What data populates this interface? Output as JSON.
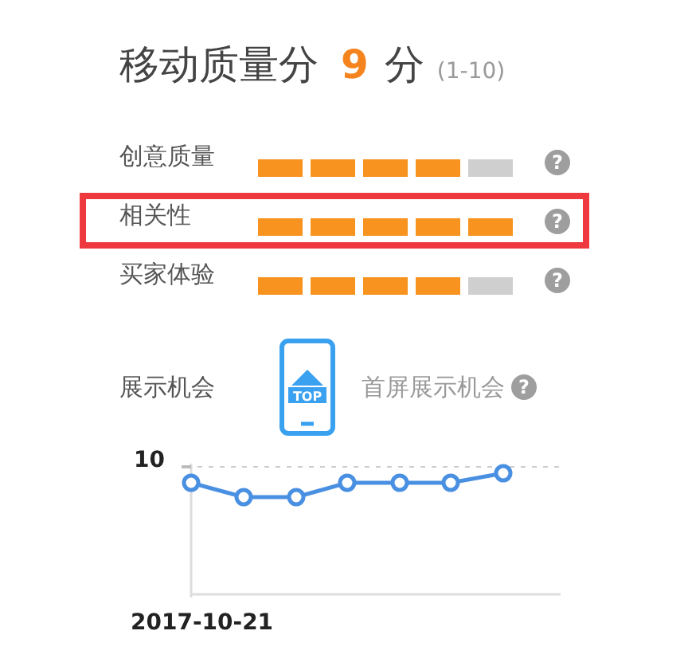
{
  "title": {
    "label": "移动质量分",
    "score": "9",
    "unit": "分",
    "range": "(1-10)"
  },
  "metrics": [
    {
      "label": "创意质量",
      "segments": [
        {
          "on": true
        },
        {
          "on": true
        },
        {
          "on": true
        },
        {
          "on": true
        },
        {
          "on": false
        }
      ],
      "highlighted": false,
      "help": "?"
    },
    {
      "label": "相关性",
      "segments": [
        {
          "on": true
        },
        {
          "on": true
        },
        {
          "on": true
        },
        {
          "on": true
        },
        {
          "on": true
        }
      ],
      "highlighted": true,
      "help": "?"
    },
    {
      "label": "买家体验",
      "segments": [
        {
          "on": true
        },
        {
          "on": true
        },
        {
          "on": true
        },
        {
          "on": true
        },
        {
          "on": false
        }
      ],
      "highlighted": false,
      "help": "?"
    }
  ],
  "exposure": {
    "label": "展示机会",
    "icon_text": "TOP",
    "value": "首屏展示机会",
    "help": "?"
  },
  "chart": {
    "y_label": "10",
    "x_label": "2017-10-21"
  }
}
